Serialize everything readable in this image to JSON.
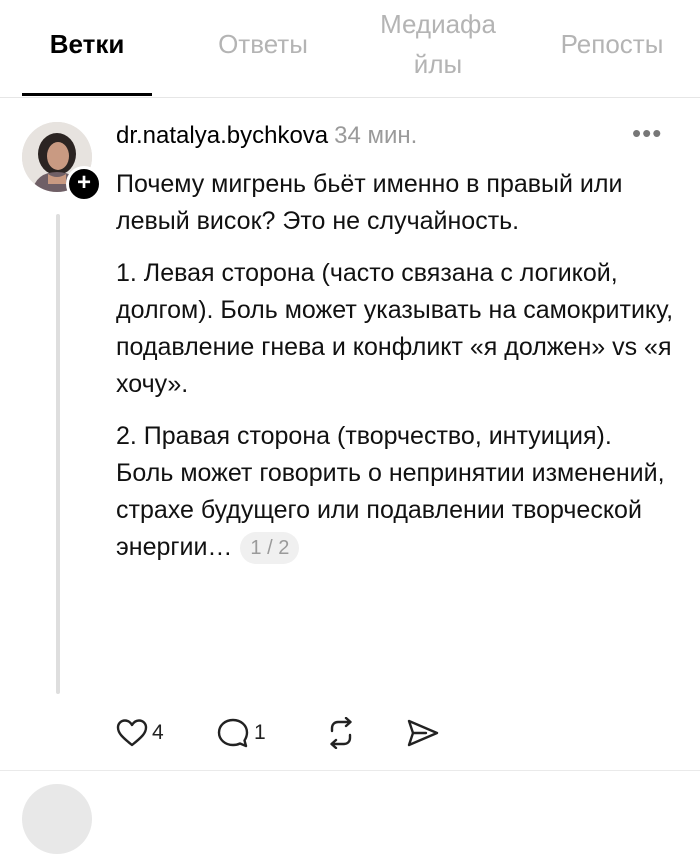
{
  "tabs": [
    {
      "label": "Ветки",
      "active": true
    },
    {
      "label": "Ответы",
      "active": false
    },
    {
      "label": "Медиафа\nйлы",
      "active": false
    },
    {
      "label": "Репосты",
      "active": false
    }
  ],
  "post": {
    "username": "dr.natalya.bychkova",
    "timestamp": "34 мин.",
    "more": "•••",
    "follow": "+",
    "paragraphs": [
      "Почему мигрень бьёт именно в правый или левый висок? Это не случайность.",
      "1. Левая сторона (часто связана с логикой, долгом). Боль может указывать на самокритику, подавление гнева и конфликт «я должен» vs «я хочу».",
      "2. Правая сторона (творчество, интуиция). Боль может говорить о непринятии изменений, страхе будущего или подавлении творческой энергии…"
    ],
    "pager": "1 / 2",
    "actions": {
      "likes": "4",
      "replies": "1"
    }
  },
  "icons": {
    "like": "heart-icon",
    "reply": "comment-icon",
    "repost": "repost-icon",
    "share": "send-icon"
  },
  "colors": {
    "active_tab": "#000000",
    "inactive_tab": "#b4b4b4",
    "muted_text": "#9a9a9a"
  }
}
